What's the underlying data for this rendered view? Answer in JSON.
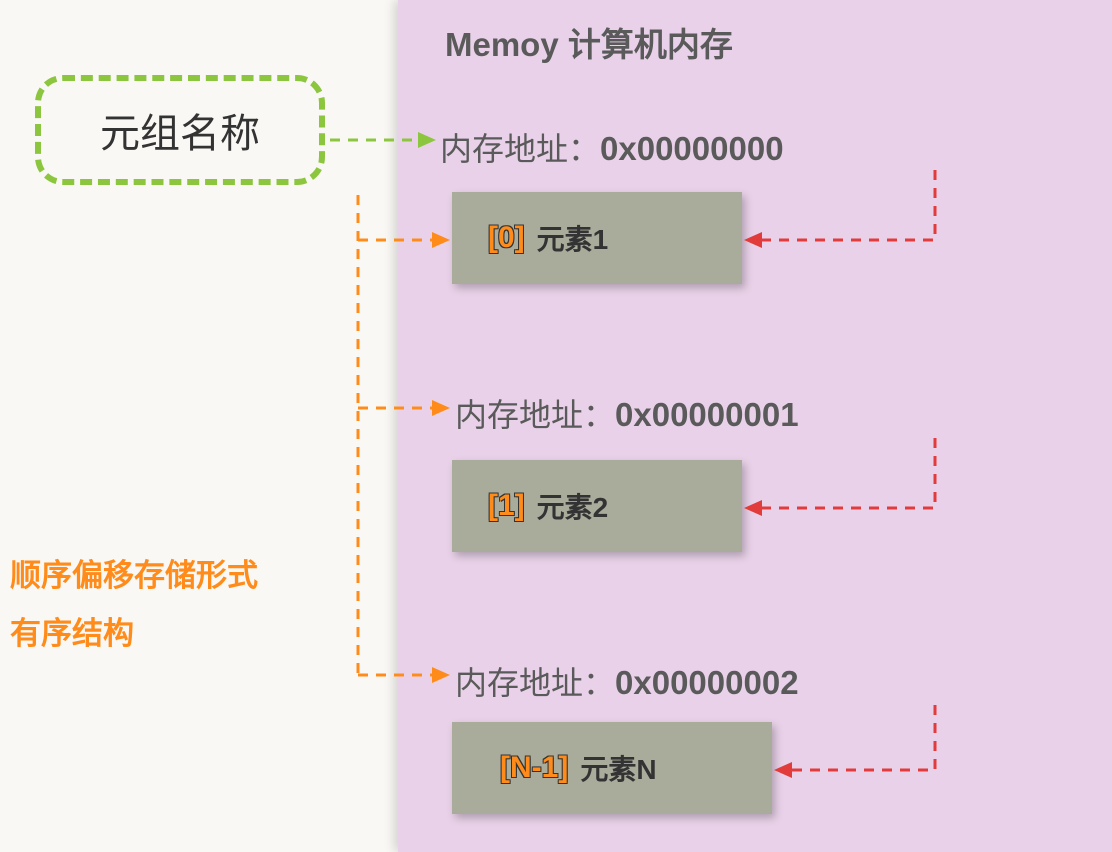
{
  "panel": {
    "title": "Memoy 计算机内存"
  },
  "tuple_name": {
    "label": "元组名称"
  },
  "addresses": {
    "label": "内存地址：",
    "a1": "0x00000000",
    "a2": "0x00000001",
    "a3": "0x00000002"
  },
  "elements": {
    "idx0": "[0]",
    "e0": "元素1",
    "idx1": "[1]",
    "e1": "元素2",
    "idxN": "[N-1]",
    "eN": "元素N"
  },
  "description": {
    "line1": "顺序偏移存储形式",
    "line2": "有序结构"
  }
}
